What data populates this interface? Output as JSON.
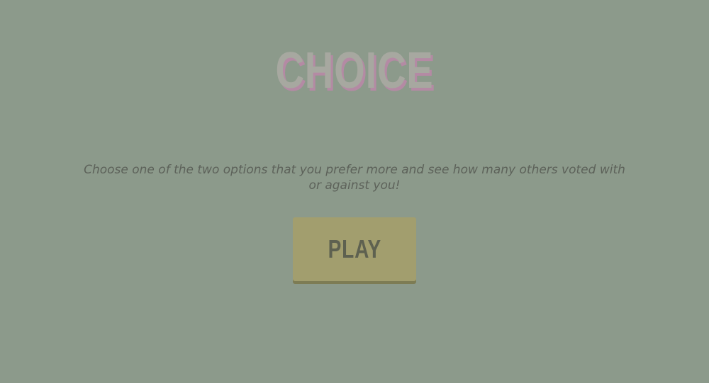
{
  "game": {
    "title": "CHOICE",
    "description": "Choose one of the two options that you prefer more and see how many others voted with or against you!",
    "play_label": "PLAY"
  },
  "colors": {
    "background": "#8c9a8b",
    "title": "#a7a8a0",
    "title_shadow": "#b48aa4",
    "button": "#a29e6e",
    "button_text": "#5e6150"
  }
}
